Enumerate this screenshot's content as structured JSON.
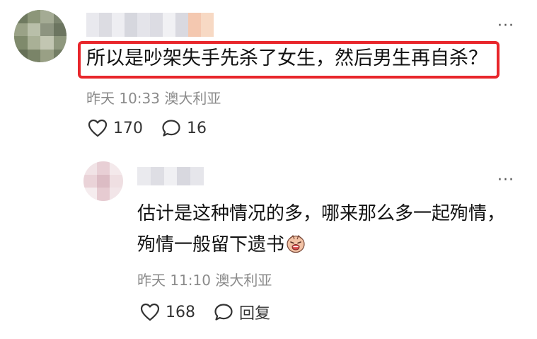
{
  "comment": {
    "text": "所以是吵架失手先杀了女生，然后男生再自杀？",
    "time": "昨天 10:33",
    "location": "澳大利亚",
    "likes": "170",
    "replies": "16"
  },
  "reply": {
    "text": "估计是这种情况的多，哪来那么多一起殉情，殉情一般留下遗书",
    "time": "昨天 11:10",
    "location": "澳大利亚",
    "likes": "168",
    "reply_label": "回复"
  },
  "more_label": "···",
  "colors": {
    "highlight_border": "#e8262b",
    "meta_text": "#8a8a8a"
  }
}
